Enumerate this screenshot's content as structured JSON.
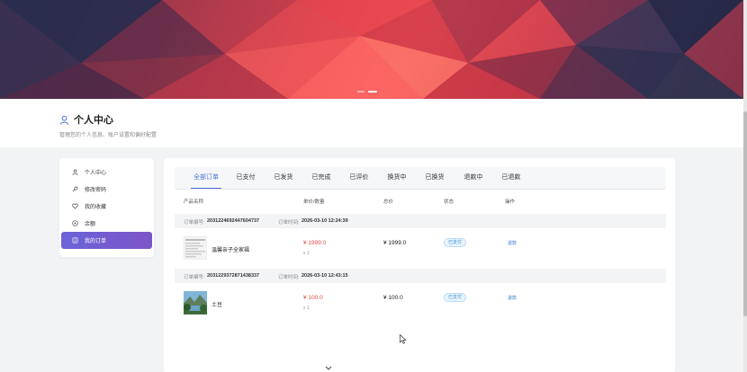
{
  "banner": {
    "slides": 2,
    "active_slide": 1
  },
  "header": {
    "title": "个人中心",
    "subtitle": "管理您的个人信息、账户设置和偏好配置"
  },
  "sidebar": {
    "items": [
      {
        "label": "个人中心",
        "icon": "user-icon"
      },
      {
        "label": "修改密码",
        "icon": "key-icon"
      },
      {
        "label": "我的收藏",
        "icon": "heart-icon"
      },
      {
        "label": "余额",
        "icon": "balance-icon"
      },
      {
        "label": "我的订单",
        "icon": "order-icon",
        "active": true
      }
    ]
  },
  "tabs": [
    "全部订单",
    "已支付",
    "已发货",
    "已完成",
    "已评价",
    "换货中",
    "已换货",
    "退款中",
    "已退款"
  ],
  "table": {
    "headers": [
      "产品名称",
      "单价/数量",
      "总价",
      "状态",
      "操作"
    ]
  },
  "orders": [
    {
      "number_label": "订单编号:",
      "number": "2031224692447604737",
      "time_label": "订单时间:",
      "time": "2026-03-10 12:24:39",
      "product": "温馨亲子全家福",
      "price": "¥ 1999.0",
      "qty": "x 1",
      "total": "¥ 1999.0",
      "status": "已支付",
      "action": "退款"
    },
    {
      "number_label": "订单编号:",
      "number": "2031229372871438337",
      "time_label": "订单时间:",
      "time": "2026-03-10 12:43:15",
      "product": "土豆",
      "price": "¥ 100.0",
      "qty": "x 1",
      "total": "¥ 100.0",
      "status": "已支付",
      "action": "退款"
    }
  ],
  "colors": {
    "accent": "#4b6fd6",
    "active_menu": "#6c63d8",
    "price": "#e24b4b",
    "status_badge": "#3a8fd0"
  }
}
